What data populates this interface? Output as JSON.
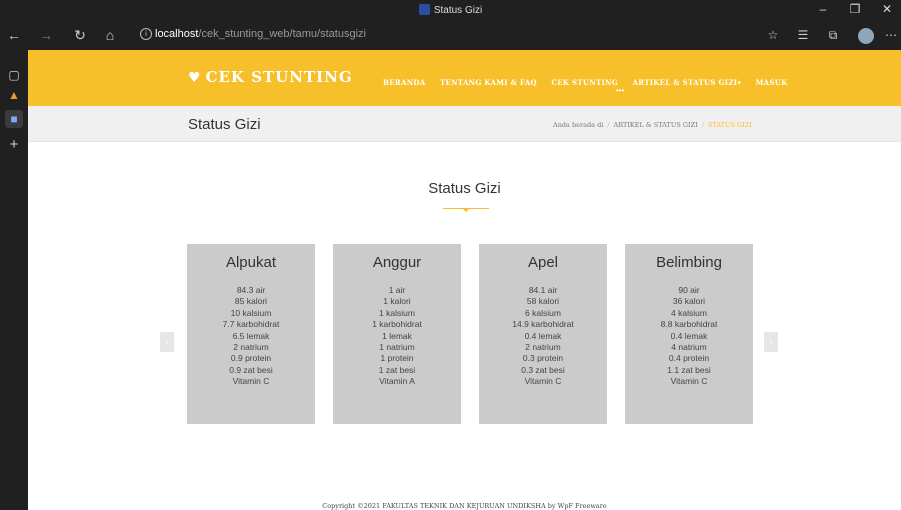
{
  "browser": {
    "tab_title": "Status Gizi",
    "url_host": "localhost",
    "url_path": "/cek_stunting_web/tamu/statusgizi"
  },
  "site": {
    "logo": "CEK STUNTING",
    "menu": [
      "BERANDA",
      "TENTANG KAMI & FAQ",
      "CEK STUNTING",
      "ARTIKEL & STATUS GIZI",
      "MASUK"
    ],
    "menu_dropdown_caret": "▾",
    "menu_more": "•••"
  },
  "page_bar": {
    "title": "Status Gizi",
    "breadcrumb_prefix": "Anda berada di",
    "breadcrumb_parent": "Artikel & Status Gizi",
    "breadcrumb_current": "Status Gizi"
  },
  "section": {
    "title": "Status Gizi"
  },
  "cards": [
    {
      "name": "Alpukat",
      "items": [
        "84.3 air",
        "85 kalori",
        "10 kalsium",
        "7.7 karbohidrat",
        "6.5 lemak",
        "2 natrium",
        "0.9 protein",
        "0.9 zat besi",
        "Vitamin C"
      ]
    },
    {
      "name": "Anggur",
      "items": [
        "1 air",
        "1 kalori",
        "1 kalsium",
        "1 karbohidrat",
        "1 lemak",
        "1 natrium",
        "1 protein",
        "1 zat besi",
        "Vitamin A"
      ]
    },
    {
      "name": "Apel",
      "items": [
        "84.1 air",
        "58 kalori",
        "6 kalsium",
        "14.9 karbohidrat",
        "0.4 lemak",
        "2 natrium",
        "0.3 protein",
        "0.3 zat besi",
        "Vitamin C"
      ]
    },
    {
      "name": "Belimbing",
      "items": [
        "90 air",
        "36 kalori",
        "4 kalsium",
        "8.8 karbohidrat",
        "0.4 lemak",
        "4 natrium",
        "0.4 protein",
        "1.1 zat besi",
        "Vitamin C"
      ]
    }
  ],
  "footer": {
    "text": "Copyright ©2021 FAKULTAS TEKNIK DAN KEJURUAN UNDIKSHA by WpF Freeware"
  },
  "colors": {
    "accent": "#f7c02a",
    "card_bg": "#cbcbcb",
    "page_bar_bg": "#f0f0f0"
  },
  "icons": {
    "back": "back-arrow-icon",
    "forward": "forward-arrow-icon",
    "refresh": "refresh-icon",
    "home": "home-icon",
    "info": "info-icon",
    "logo": "heart-pulse-icon"
  }
}
